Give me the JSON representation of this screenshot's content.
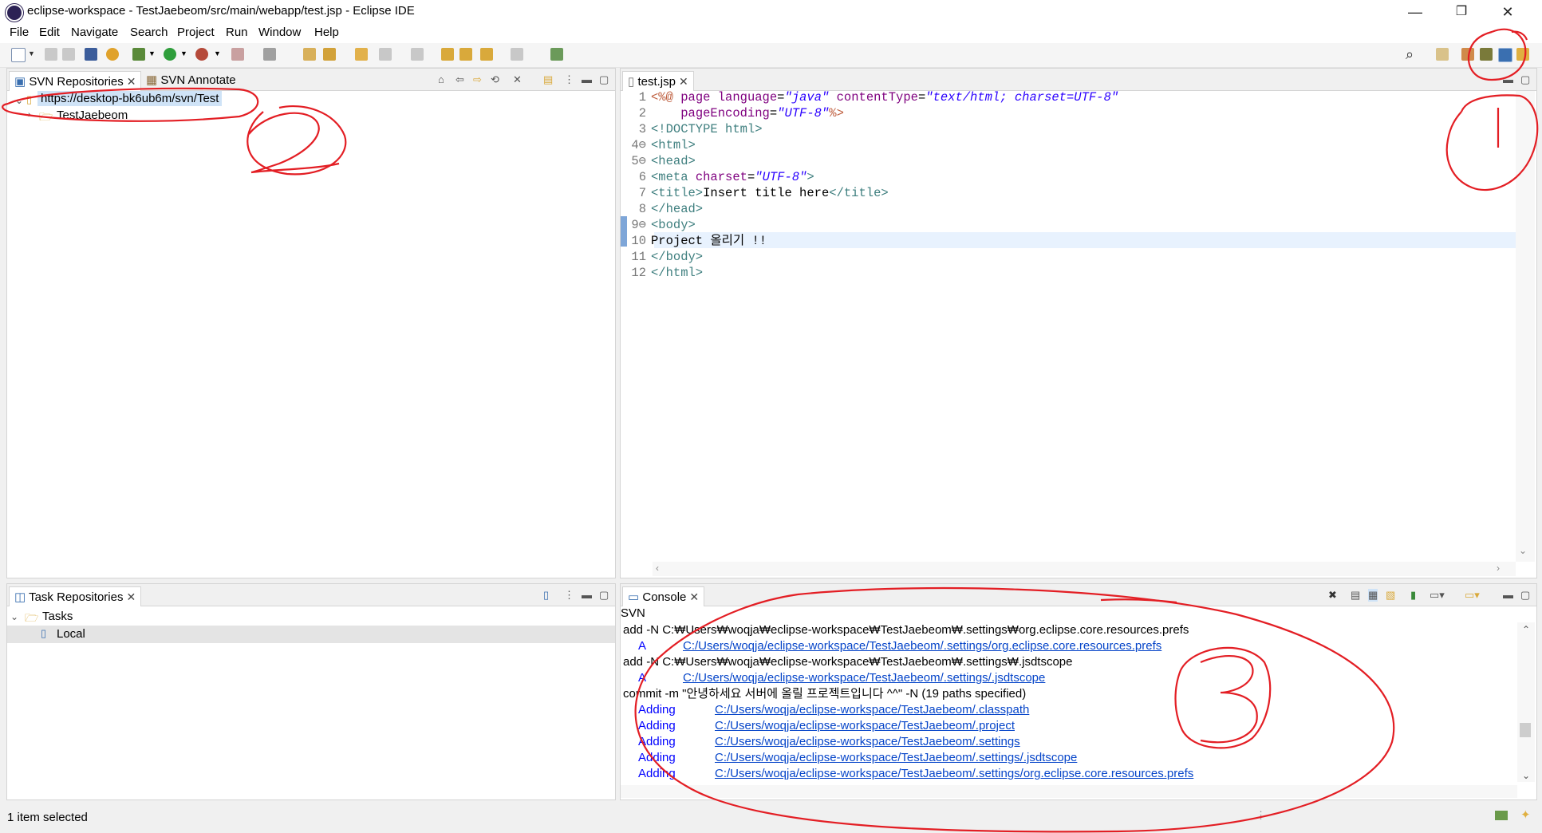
{
  "window": {
    "title": "eclipse-workspace - TestJaebeom/src/main/webapp/test.jsp - Eclipse IDE",
    "minimize": "—",
    "maximize": "❐",
    "close": "✕"
  },
  "menu": [
    "File",
    "Edit",
    "Navigate",
    "Search",
    "Project",
    "Run",
    "Window",
    "Help"
  ],
  "svn_view": {
    "tabs": [
      "SVN Repositories",
      "SVN Annotate"
    ],
    "repo_url": "https://desktop-bk6ub6m/svn/Test",
    "child": "TestJaebeom"
  },
  "task_view": {
    "tab": "Task Repositories",
    "group": "Tasks",
    "item": "Local"
  },
  "editor": {
    "tab": "test.jsp",
    "lines": [
      {
        "n": "1",
        "html": "<span class='jsp'>&lt;%@</span> <span class='attr'>page</span> <span class='attr'>language</span>=<span class='val'>\"java\"</span> <span class='attr'>contentType</span>=<span class='val'>\"text/html; charset=UTF-8\"</span>"
      },
      {
        "n": "2",
        "html": "    <span class='attr'>pageEncoding</span>=<span class='val'>\"UTF-8\"</span><span class='jsp'>%&gt;</span>"
      },
      {
        "n": "3",
        "html": "<span class='tagc'>&lt;!DOCTYPE html&gt;</span>"
      },
      {
        "n": "4⊖",
        "html": "<span class='tagc'>&lt;html&gt;</span>"
      },
      {
        "n": "5⊖",
        "html": "<span class='tagc'>&lt;head&gt;</span>"
      },
      {
        "n": "6",
        "html": "<span class='tagc'>&lt;meta</span> <span class='attr'>charset</span>=<span class='val'>\"UTF-8\"</span><span class='tagc'>&gt;</span>"
      },
      {
        "n": "7",
        "html": "<span class='tagc'>&lt;title&gt;</span>Insert title here<span class='tagc'>&lt;/title&gt;</span>"
      },
      {
        "n": "8",
        "html": "<span class='tagc'>&lt;/head&gt;</span>"
      },
      {
        "n": "9⊖",
        "html": "<span class='tagc'>&lt;body&gt;</span>"
      },
      {
        "n": "10",
        "html": "Project 올리기 !!"
      },
      {
        "n": "11",
        "html": "<span class='tagc'>&lt;/body&gt;</span>"
      },
      {
        "n": "12",
        "html": "<span class='tagc'>&lt;/html&gt;</span>"
      }
    ]
  },
  "console": {
    "tab": "Console",
    "label": "SVN",
    "lines": [
      {
        "kind": "plain",
        "text": "add -N C:₩Users₩woqja₩eclipse-workspace₩TestJaebeom₩.settings₩org.eclipse.core.resources.prefs"
      },
      {
        "kind": "status",
        "tag": "A",
        "path": "C:/Users/woqja/eclipse-workspace/TestJaebeom/.settings/org.eclipse.core.resources.prefs"
      },
      {
        "kind": "plain",
        "text": "add -N C:₩Users₩woqja₩eclipse-workspace₩TestJaebeom₩.settings₩.jsdtscope"
      },
      {
        "kind": "status",
        "tag": "A",
        "path": "C:/Users/woqja/eclipse-workspace/TestJaebeom/.settings/.jsdtscope"
      },
      {
        "kind": "plain",
        "text": "commit -m \"안녕하세요 서버에 올릴 프로젝트입니다 ^^\" -N (19 paths specified)"
      },
      {
        "kind": "adding",
        "tag": "Adding",
        "path": "C:/Users/woqja/eclipse-workspace/TestJaebeom/.classpath"
      },
      {
        "kind": "adding",
        "tag": "Adding",
        "path": "C:/Users/woqja/eclipse-workspace/TestJaebeom/.project"
      },
      {
        "kind": "adding",
        "tag": "Adding",
        "path": "C:/Users/woqja/eclipse-workspace/TestJaebeom/.settings"
      },
      {
        "kind": "adding",
        "tag": "Adding",
        "path": "C:/Users/woqja/eclipse-workspace/TestJaebeom/.settings/.jsdtscope"
      },
      {
        "kind": "adding",
        "tag": "Adding",
        "path": "C:/Users/woqja/eclipse-workspace/TestJaebeom/.settings/org.eclipse.core.resources.prefs"
      }
    ]
  },
  "status_bar": {
    "text": "1 item selected"
  },
  "annotations": {
    "one": "1",
    "two": "2",
    "three": "3"
  }
}
